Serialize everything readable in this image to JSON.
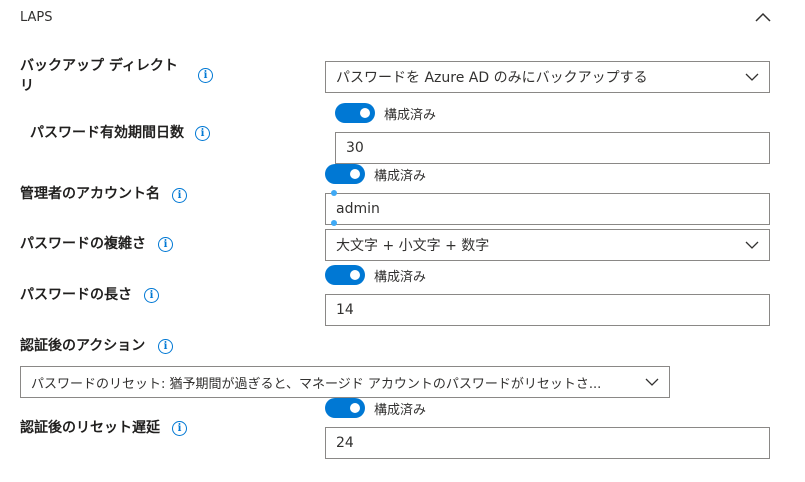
{
  "section": {
    "title": "LAPS",
    "collapse_icon": "chevron-up-icon"
  },
  "backup_directory": {
    "label_line1": "バックアップ ディレクト",
    "label_line2": "リ",
    "value": "パスワードを Azure AD のみにバックアップする"
  },
  "password_age": {
    "toggle_label": "構成済み",
    "label": "パスワード有効期間日数",
    "value": "30"
  },
  "admin_account": {
    "toggle_label": "構成済み",
    "label": "管理者のアカウント名",
    "value": "admin"
  },
  "password_complexity": {
    "label": "パスワードの複雑さ",
    "value": "大文字 + 小文字 + 数字"
  },
  "password_length": {
    "toggle_label": "構成済み",
    "label": "パスワードの長さ",
    "value": "14"
  },
  "post_auth_action": {
    "label": "認証後のアクション",
    "value": "パスワードのリセット: 猶予期間が過ぎると、マネージド アカウントのパスワードがリセットさ..."
  },
  "post_auth_reset_delay": {
    "toggle_label": "構成済み",
    "label": "認証後のリセット遅延",
    "value": "24"
  },
  "colors": {
    "accent": "#0078d4",
    "border": "#8a8886",
    "text": "#323130"
  }
}
